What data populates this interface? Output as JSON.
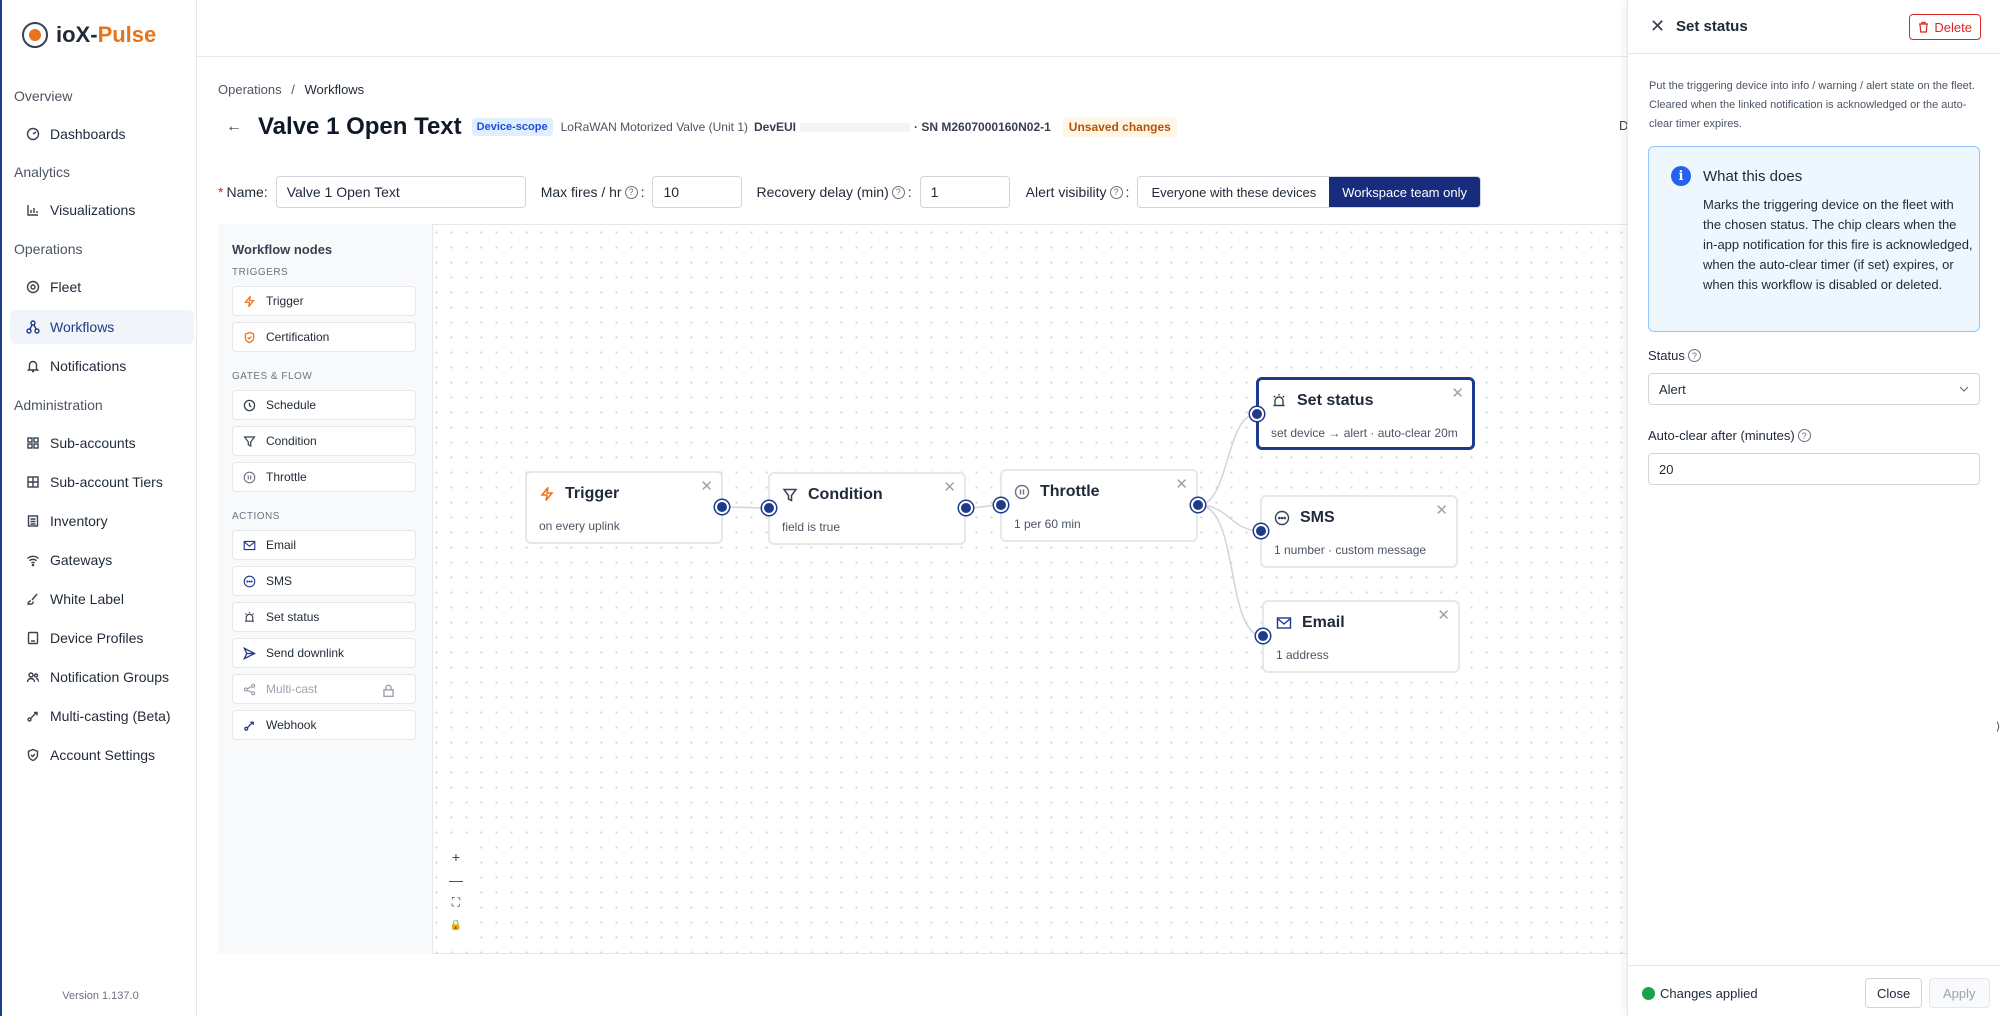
{
  "app": {
    "brand_a": "ioX-",
    "brand_b": "Pulse",
    "version": "Version 1.137.0"
  },
  "sidebar": {
    "sections": [
      "Overview",
      "Analytics",
      "Operations",
      "Administration"
    ],
    "items": [
      {
        "label": "Dashboards",
        "icon": "dashboard-icon"
      },
      {
        "label": "Visualizations",
        "icon": "chart-icon"
      },
      {
        "label": "Fleet",
        "icon": "fleet-icon"
      },
      {
        "label": "Workflows",
        "icon": "workflow-icon",
        "active": true
      },
      {
        "label": "Notifications",
        "icon": "bell-icon"
      },
      {
        "label": "Sub-accounts",
        "icon": "grid-icon"
      },
      {
        "label": "Sub-account Tiers",
        "icon": "tiers-icon"
      },
      {
        "label": "Inventory",
        "icon": "inventory-icon"
      },
      {
        "label": "Gateways",
        "icon": "wifi-icon"
      },
      {
        "label": "White Label",
        "icon": "brush-icon"
      },
      {
        "label": "Device Profiles",
        "icon": "device-icon"
      },
      {
        "label": "Notification Groups",
        "icon": "group-icon"
      },
      {
        "label": "Multi-casting (Beta)",
        "icon": "multicast-icon"
      },
      {
        "label": "Account Settings",
        "icon": "shield-icon"
      }
    ]
  },
  "breadcrumb": {
    "root": "Operations",
    "sep": "/",
    "current": "Workflows"
  },
  "header": {
    "title": "Valve 1 Open Text",
    "scope_badge": "Device-scope",
    "device": "LoRaWAN Motorized Valve (Unit 1)",
    "deveui_label": "DevEUI",
    "sn": "· SN M2607000160N02-1",
    "unsaved": "Unsaved changes",
    "stub": "D"
  },
  "form": {
    "name_req": "*",
    "name_label": "Name:",
    "name_value": "Valve 1 Open Text",
    "maxfires_label": "Max fires / hr",
    "maxfires_value": "10",
    "recovery_label": "Recovery delay (min)",
    "recovery_value": "1",
    "visibility_label": "Alert visibility",
    "vis_opt1": "Everyone with these devices",
    "vis_opt2": "Workspace team only"
  },
  "palette": {
    "title": "Workflow nodes",
    "sec_triggers": "TRIGGERS",
    "sec_gates": "GATES & FLOW",
    "sec_actions": "ACTIONS",
    "triggers": [
      "Trigger",
      "Certification"
    ],
    "gates": [
      "Schedule",
      "Condition",
      "Throttle"
    ],
    "actions": [
      "Email",
      "SMS",
      "Set status",
      "Send downlink",
      "Multi-cast",
      "Webhook"
    ]
  },
  "nodes": {
    "trigger": {
      "title": "Trigger",
      "sub": "on every uplink"
    },
    "condition": {
      "title": "Condition",
      "sub": "field is true"
    },
    "throttle": {
      "title": "Throttle",
      "sub": "1 per 60 min"
    },
    "setstatus": {
      "title": "Set status",
      "sub": "set device → alert · auto-clear 20m"
    },
    "sms": {
      "title": "SMS",
      "sub": "1 number · custom message"
    },
    "email": {
      "title": "Email",
      "sub": "1 address"
    }
  },
  "zoom": {
    "plus": "+",
    "minus": "—",
    "fit": "⛶",
    "lock": "🔒"
  },
  "panel": {
    "title": "Set status",
    "delete": "Delete",
    "desc": "Put the triggering device into info / warning / alert state on the fleet. Cleared when the linked notification is acknowledged or the auto-clear timer expires.",
    "info_title": "What this does",
    "info_body": "Marks the triggering device on the fleet with the chosen status. The chip clears when the in-app notification for this fire is acknowledged, when the auto-clear timer (if set) expires, or when this workflow is disabled or deleted.",
    "status_label": "Status",
    "status_value": "Alert",
    "autoclear_label": "Auto-clear after (minutes)",
    "autoclear_value": "20",
    "footer_status": "Changes applied",
    "close": "Close",
    "apply": "Apply"
  },
  "colors": {
    "accent": "#1e3a8a",
    "brand": "#e8731a",
    "danger": "#dc2626",
    "success": "#16a34a"
  }
}
